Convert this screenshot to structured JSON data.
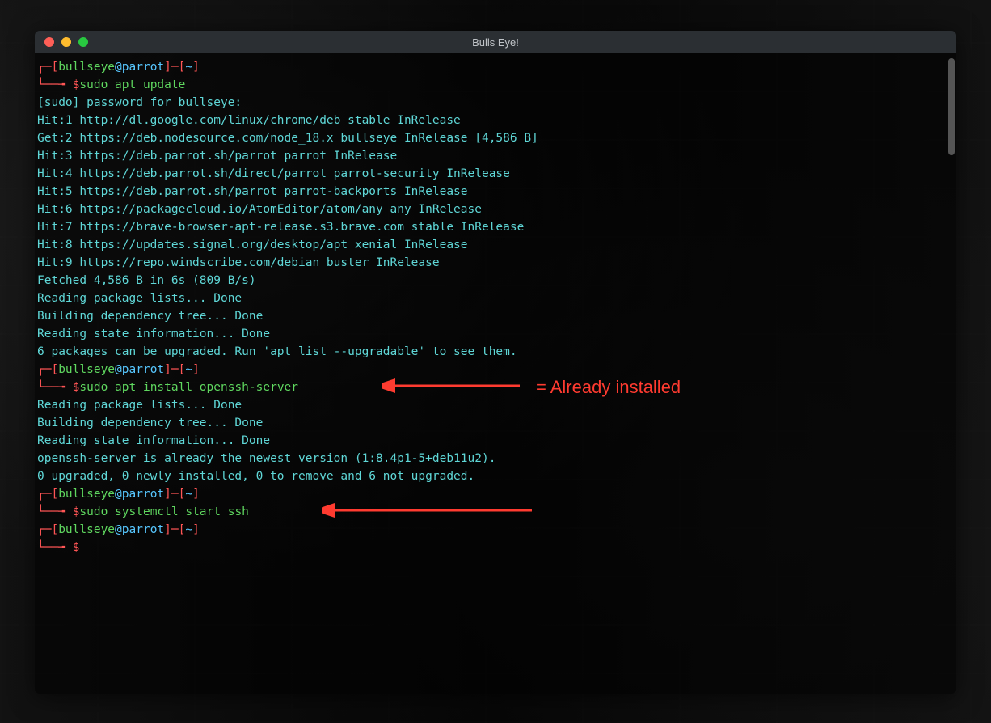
{
  "window": {
    "title": "Bulls Eye!"
  },
  "prompt": {
    "user": "bullseye",
    "host": "parrot",
    "cwd": "~",
    "sigil": "$"
  },
  "blocks": [
    {
      "cmd": "sudo apt update",
      "out": [
        "[sudo] password for bullseye:",
        "Hit:1 http://dl.google.com/linux/chrome/deb stable InRelease",
        "Get:2 https://deb.nodesource.com/node_18.x bullseye InRelease [4,586 B]",
        "Hit:3 https://deb.parrot.sh/parrot parrot InRelease",
        "Hit:4 https://deb.parrot.sh/direct/parrot parrot-security InRelease",
        "Hit:5 https://deb.parrot.sh/parrot parrot-backports InRelease",
        "Hit:6 https://packagecloud.io/AtomEditor/atom/any any InRelease",
        "Hit:7 https://brave-browser-apt-release.s3.brave.com stable InRelease",
        "Hit:8 https://updates.signal.org/desktop/apt xenial InRelease",
        "Hit:9 https://repo.windscribe.com/debian buster InRelease",
        "Fetched 4,586 B in 6s (809 B/s)",
        "Reading package lists... Done",
        "Building dependency tree... Done",
        "Reading state information... Done",
        "6 packages can be upgraded. Run 'apt list --upgradable' to see them."
      ]
    },
    {
      "cmd": "sudo apt install openssh-server",
      "out": [
        "Reading package lists... Done",
        "Building dependency tree... Done",
        "Reading state information... Done",
        "openssh-server is already the newest version (1:8.4p1-5+deb11u2).",
        "0 upgraded, 0 newly installed, 0 to remove and 6 not upgraded."
      ]
    },
    {
      "cmd": "sudo systemctl start ssh",
      "out": []
    },
    {
      "cmd": "",
      "out": []
    }
  ],
  "annotation": {
    "text": "= Already installed"
  },
  "colors": {
    "red": "#ff5555",
    "green": "#5fd75f",
    "tealBright": "#57c7ff",
    "teal": "#5fd7d7",
    "annotation": "#ff3b30"
  }
}
